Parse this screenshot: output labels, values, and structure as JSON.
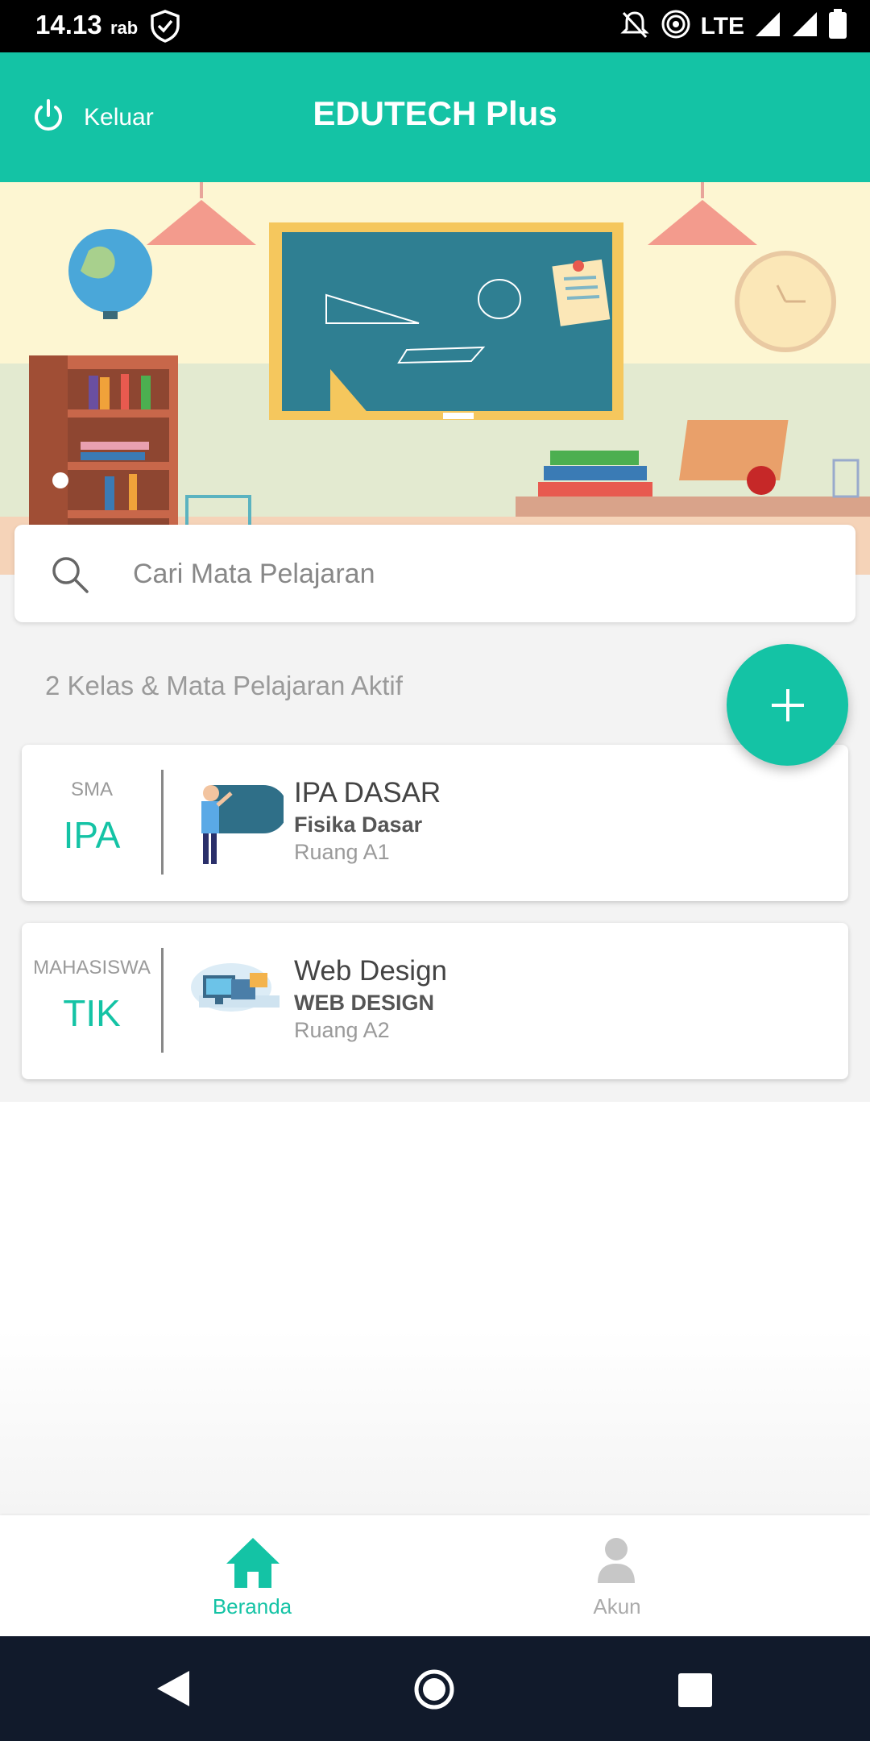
{
  "status_bar": {
    "time": "14.13",
    "day": "rab",
    "network": "LTE"
  },
  "app_bar": {
    "logout_label": "Keluar",
    "title": "EDUTECH Plus"
  },
  "search": {
    "placeholder": "Cari Mata Pelajaran"
  },
  "summary": {
    "active_count_label": "2 Kelas & Mata Pelajaran Aktif"
  },
  "classes": [
    {
      "level": "SMA",
      "code": "IPA",
      "name": "IPA DASAR",
      "subject": "Fisika Dasar",
      "room": "Ruang A1"
    },
    {
      "level": "MAHASISWA",
      "code": "TIK",
      "name": "Web Design",
      "subject": "WEB DESIGN",
      "room": "Ruang A2"
    }
  ],
  "bottom_nav": [
    {
      "label": "Beranda",
      "icon": "home-icon",
      "active": true
    },
    {
      "label": "Akun",
      "icon": "person-icon",
      "active": false
    }
  ],
  "colors": {
    "primary": "#14c3a5",
    "nav_inactive": "#aaaaaa",
    "system_nav": "#111a2b"
  }
}
